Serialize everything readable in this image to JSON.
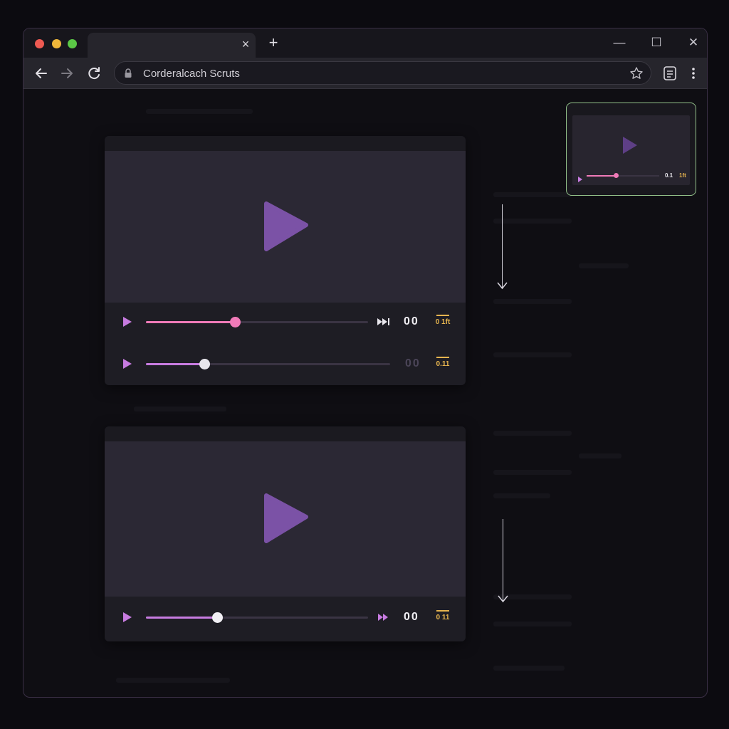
{
  "browser": {
    "tab_close_glyph": "×",
    "new_tab_glyph": "+",
    "address_bar": {
      "url": "Corderalcach Scruts"
    },
    "window_controls": {
      "minimize": "—",
      "maximize": "☐",
      "close": "✕"
    }
  },
  "players": [
    {
      "rows": [
        {
          "progress": 0.4,
          "time": "00",
          "cc_label": "0 1ft",
          "active": true
        },
        {
          "progress": 0.24,
          "time": "00",
          "cc_label": "0.11",
          "active": false
        }
      ]
    },
    {
      "rows": [
        {
          "progress": 0.32,
          "time": "00",
          "cc_label": "0 11",
          "active": true
        }
      ]
    }
  ],
  "pip": {
    "progress": 0.4,
    "time": "0.1",
    "cc_label": "1ft"
  },
  "colors": {
    "accent_pink": "#f07ab8",
    "accent_violet": "#c77be0",
    "play_purple": "#7b52a6",
    "pip_border": "#93c28a",
    "caption_gold": "#e6b44f"
  },
  "icons": [
    "back-arrow-icon",
    "forward-arrow-icon",
    "reload-icon",
    "lock-icon",
    "star-icon",
    "reading-list-icon",
    "kebab-menu-icon",
    "play-icon",
    "skip-forward-icon",
    "captions-icon",
    "scroll-down-arrow-icon"
  ]
}
